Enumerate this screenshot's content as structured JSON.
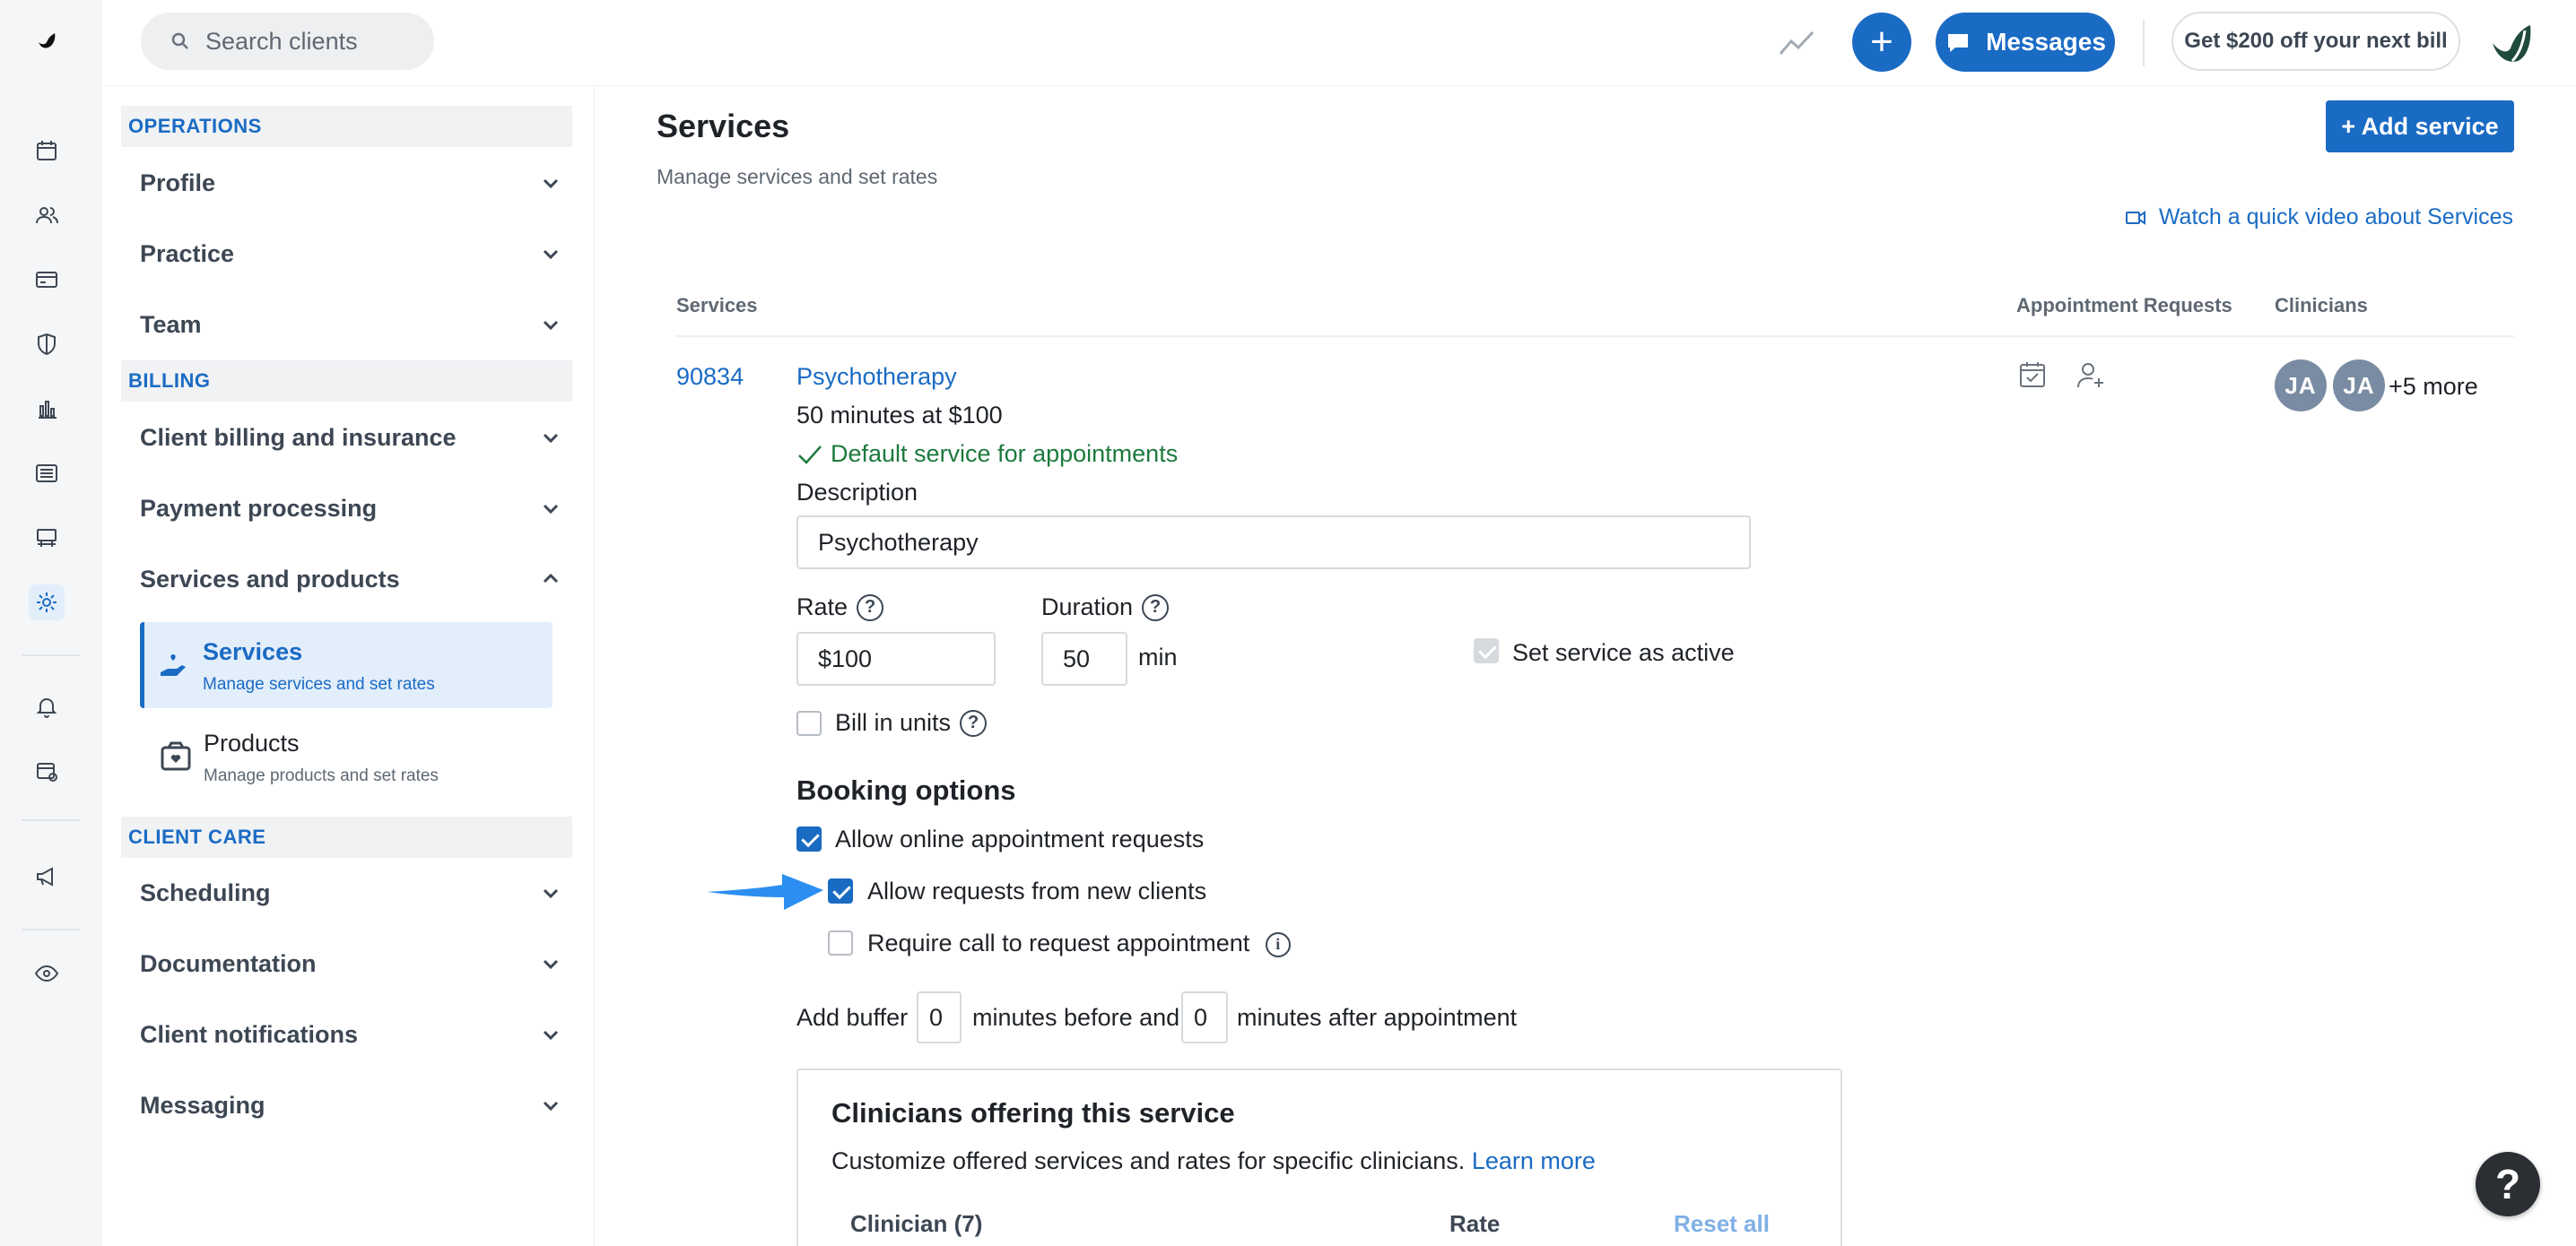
{
  "search": {
    "placeholder": "Search clients"
  },
  "topbar": {
    "messages_label": "Messages",
    "promo_label": "Get $200 off your next bill",
    "add_icon": "plus-icon"
  },
  "settings_nav": {
    "sections": [
      {
        "title": "OPERATIONS",
        "items": [
          "Profile",
          "Practice",
          "Team"
        ]
      },
      {
        "title": "BILLING",
        "items": [
          "Client billing and insurance",
          "Payment processing",
          "Services and products"
        ]
      },
      {
        "title": "CLIENT CARE",
        "items": [
          "Scheduling",
          "Documentation",
          "Client notifications",
          "Messaging"
        ]
      }
    ],
    "sub_items": [
      {
        "title": "Services",
        "desc": "Manage services and set rates",
        "active": true
      },
      {
        "title": "Products",
        "desc": "Manage products and set rates",
        "active": false
      }
    ]
  },
  "page": {
    "title": "Services",
    "subtitle": "Manage services and set rates",
    "add_button": "+ Add service",
    "video_link": "Watch a quick video about Services"
  },
  "table": {
    "headers": [
      "Services",
      "Appointment Requests",
      "Clinicians"
    ]
  },
  "service": {
    "code": "90834",
    "name": "Psychotherapy",
    "summary": "50 minutes at $100",
    "default_label": "Default service for appointments",
    "description_label": "Description",
    "description_value": "Psychotherapy",
    "rate_label": "Rate",
    "rate_value": "$100",
    "duration_label": "Duration",
    "duration_value": "50",
    "duration_unit": "min",
    "active_label": "Set service as active",
    "active_checked": true,
    "bill_units_label": "Bill in units",
    "bill_units_checked": false,
    "clinician_avatars": [
      "JA",
      "JA"
    ],
    "more_clinicians": "+5 more"
  },
  "booking": {
    "title": "Booking options",
    "allow_online": {
      "label": "Allow online appointment requests",
      "checked": true
    },
    "allow_new": {
      "label": "Allow requests from new clients",
      "checked": true
    },
    "require_call": {
      "label": "Require call to request appointment",
      "checked": false
    },
    "buffer_prefix": "Add buffer",
    "buffer_before": "0",
    "buffer_middle": "minutes before and",
    "buffer_after": "0",
    "buffer_suffix": "minutes after appointment"
  },
  "clinicians_card": {
    "title": "Clinicians offering this service",
    "desc": "Customize offered services and rates for specific clinicians.",
    "learn_more": "Learn more",
    "col_clinician": "Clinician (7)",
    "col_rate": "Rate",
    "reset_all": "Reset all"
  },
  "help": {
    "label": "?"
  },
  "colors": {
    "accent": "#1a6bc4",
    "success": "#1d7a3d",
    "arrow": "#2b8ef0"
  }
}
